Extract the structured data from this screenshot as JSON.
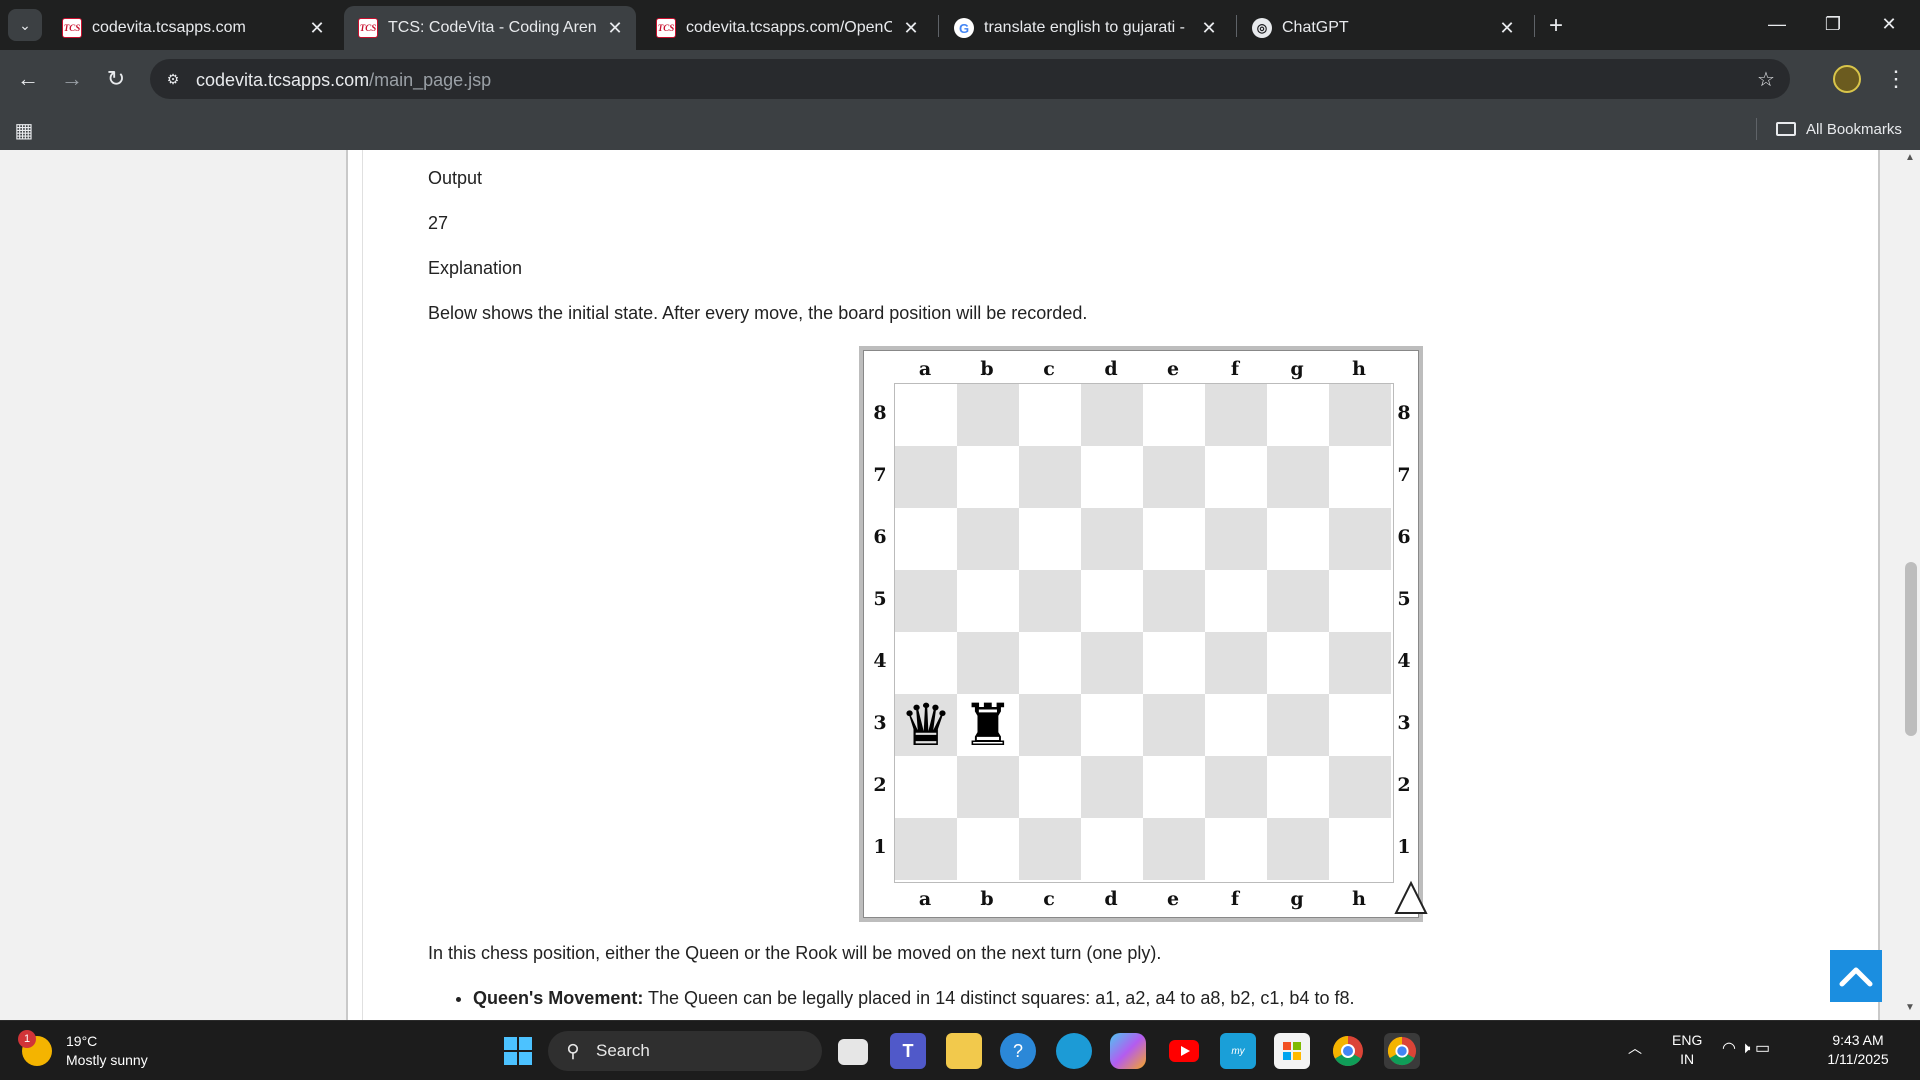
{
  "browser": {
    "tabs": [
      {
        "title": "codevita.tcsapps.com",
        "favicon": "tcs-favicon",
        "active": false
      },
      {
        "title": "TCS: CodeVita - Coding Arena",
        "favicon": "tcs-favicon",
        "active": true
      },
      {
        "title": "codevita.tcsapps.com/OpenCod",
        "favicon": "tcs-favicon",
        "active": false
      },
      {
        "title": "translate english to gujarati - Go",
        "favicon": "google-favicon",
        "active": false
      },
      {
        "title": "ChatGPT",
        "favicon": "chatgpt-favicon",
        "active": false
      }
    ],
    "favicon_text": {
      "tcs": "TCS",
      "google": "G",
      "chatgpt": "◎"
    },
    "url": {
      "host": "codevita.tcsapps.com",
      "path": "/main_page.jsp"
    },
    "bookmarks": {
      "all_label": "All Bookmarks"
    }
  },
  "page": {
    "output_label": "Output",
    "output_value": "27",
    "explanation_label": "Explanation",
    "intro": "Below shows the initial state. After every move, the board position will be recorded.",
    "after_board": "In this chess position, either the Queen or the Rook will be moved on the next turn (one ply).",
    "bullets": [
      {
        "bold": "Queen's Movement:",
        "text": " The Queen can be legally placed in 14 distinct squares: a1, a2, a4 to a8, b2, c1, b4 to f8."
      }
    ]
  },
  "chess": {
    "files": [
      "a",
      "b",
      "c",
      "d",
      "e",
      "f",
      "g",
      "h"
    ],
    "ranks": [
      "8",
      "7",
      "6",
      "5",
      "4",
      "3",
      "2",
      "1"
    ],
    "pieces": [
      {
        "square": "a3",
        "glyph": "♛",
        "name": "black-queen"
      },
      {
        "square": "b3",
        "glyph": "♜",
        "name": "black-rook"
      }
    ],
    "side_to_move_icon": "white-triangle-icon",
    "colors": {
      "light": "#ffffff",
      "dark": "#e0e0e0"
    }
  },
  "taskbar": {
    "weather": {
      "temp": "19°C",
      "condition": "Mostly sunny",
      "badge": "1"
    },
    "search_label": "Search",
    "lang": {
      "line1": "ENG",
      "line2": "IN"
    },
    "clock": {
      "time": "9:43 AM",
      "date": "1/11/2025"
    }
  },
  "colors": {
    "accent_scroll_top": "#1b8ee0",
    "tab_active": "#3c4043",
    "windows_blue": "#4cc2ff"
  }
}
